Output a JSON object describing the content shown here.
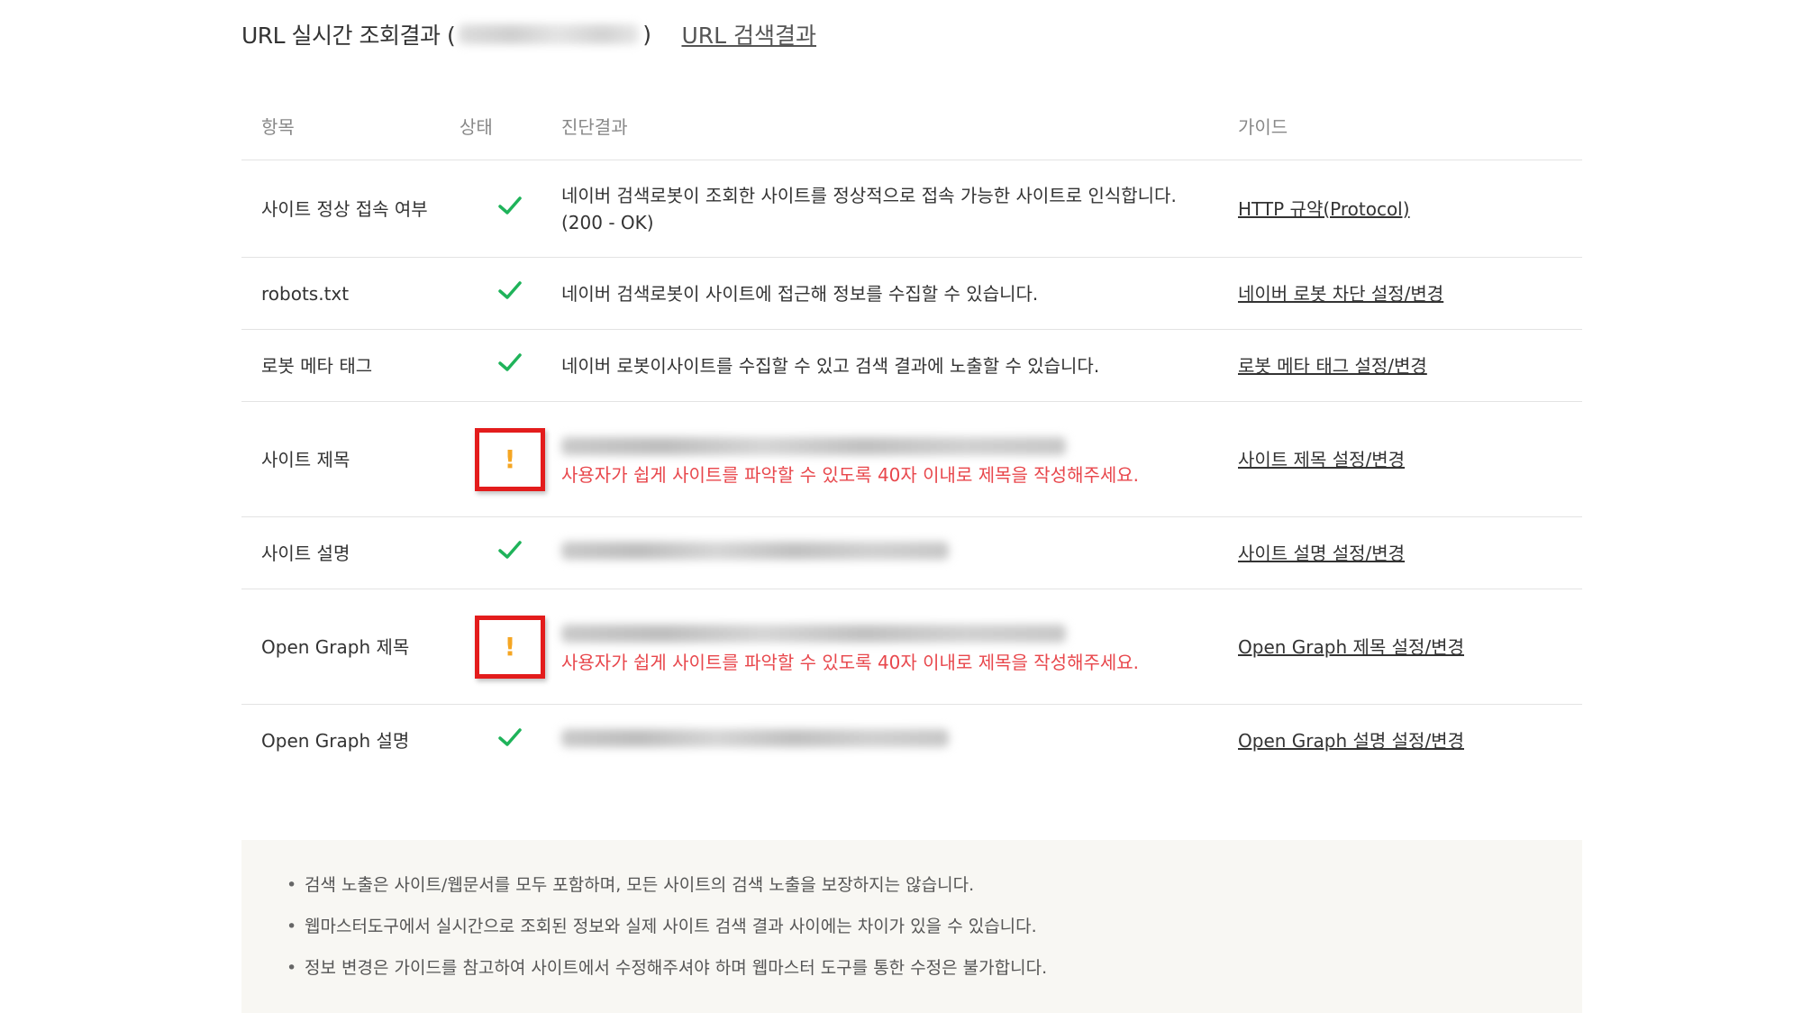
{
  "header": {
    "title_prefix": "URL 실시간 조회결과 (",
    "title_suffix": ")",
    "search_link": "URL 검색결과"
  },
  "table": {
    "headers": {
      "item": "항목",
      "status": "상태",
      "result": "진단결과",
      "guide": "가이드"
    },
    "rows": [
      {
        "item": "사이트 정상 접속 여부",
        "status": "ok",
        "result_line1": "네이버 검색로봇이 조회한 사이트를 정상적으로 접속 가능한 사이트로 인식합니다.",
        "result_line2": "(200 - OK)",
        "guide": "HTTP 규약(Protocol)"
      },
      {
        "item": "robots.txt",
        "status": "ok",
        "result_line1": "네이버 검색로봇이 사이트에 접근해 정보를 수집할 수 있습니다.",
        "guide": "네이버 로봇 차단 설정/변경"
      },
      {
        "item": "로봇 메타 태그",
        "status": "ok",
        "result_line1": "네이버 로봇이사이트를 수집할 수 있고 검색 결과에 노출할 수 있습니다.",
        "guide": "로봇 메타 태그 설정/변경"
      },
      {
        "item": "사이트 제목",
        "status": "warning",
        "result_warning": "사용자가 쉽게 사이트를 파악할 수 있도록 40자 이내로 제목을 작성해주세요.",
        "guide": "사이트 제목 설정/변경"
      },
      {
        "item": "사이트 설명",
        "status": "ok",
        "guide": "사이트 설명 설정/변경"
      },
      {
        "item": "Open Graph 제목",
        "status": "warning",
        "result_warning": "사용자가 쉽게 사이트를 파악할 수 있도록 40자 이내로 제목을 작성해주세요.",
        "guide": "Open Graph 제목 설정/변경"
      },
      {
        "item": "Open Graph 설명",
        "status": "ok",
        "guide": "Open Graph 설명 설정/변경"
      }
    ]
  },
  "notice": {
    "items": [
      "검색 노출은 사이트/웹문서를 모두 포함하며, 모든 사이트의 검색 노출을 보장하지는 않습니다.",
      "웹마스터도구에서 실시간으로 조회된 정보와 실제 사이트 검색 결과 사이에는 차이가 있을 수 있습니다.",
      "정보 변경은 가이드를 참고하여 사이트에서 수정해주셔야 하며 웹마스터 도구를 통한 수정은 불가합니다."
    ]
  },
  "colors": {
    "check": "#1fb35a",
    "warning_icon": "#f5a623",
    "highlight_box": "#e31c1c",
    "warning_text": "#e8474c",
    "notice_bg": "#f8f7f3"
  },
  "icons": {
    "ok": "check-icon",
    "warning": "exclamation-icon"
  }
}
